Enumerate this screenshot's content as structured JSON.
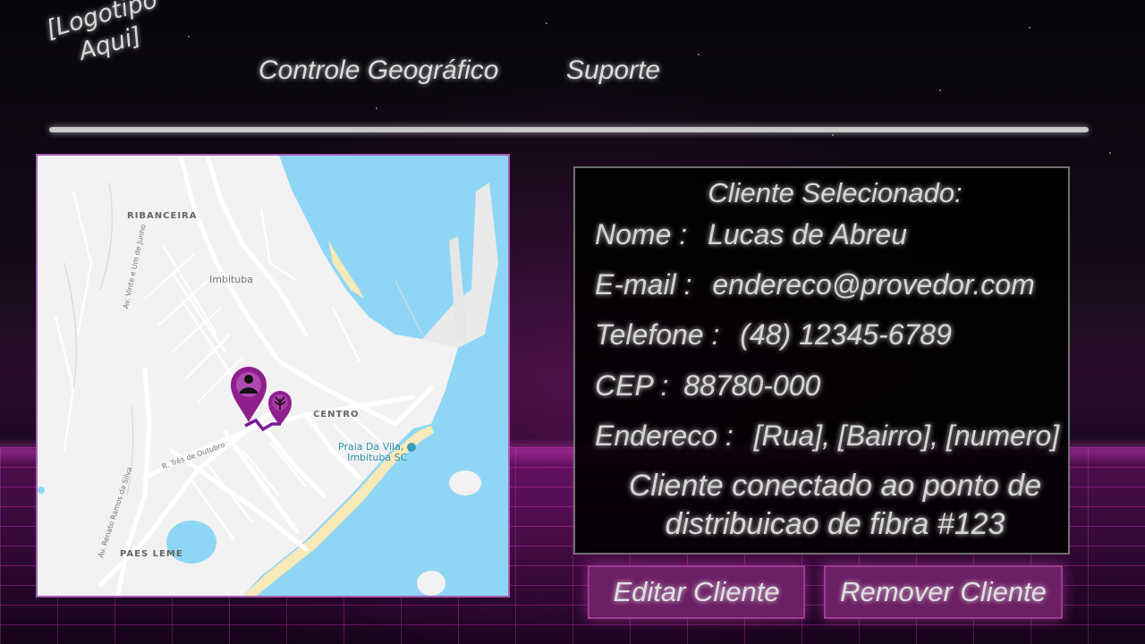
{
  "header": {
    "logo_line1": "[Logotipo",
    "logo_line2": "Aqui]",
    "nav": [
      {
        "label": "Controle Geográfico"
      },
      {
        "label": "Suporte"
      }
    ]
  },
  "map": {
    "labels": {
      "ribanceira": "RIBANCEIRA",
      "imbituba": "Imbituba",
      "centro": "CENTRO",
      "paes_leme": "PAES LEME",
      "poi_line1": "Praia Da Vila,",
      "poi_line2": "Imbituba SC",
      "street_vinte": "Av. Vinte e Um de Junho",
      "street_tres": "R. Três de Outubro",
      "street_renato": "Av. Renato Ramos da Silva"
    },
    "markers": [
      {
        "icon": "person-icon"
      },
      {
        "icon": "fiber-distribution-icon"
      }
    ],
    "colors": {
      "water": "#8fd6f6",
      "land": "#f2f2f2",
      "road": "#ffffff",
      "sand": "#f7e9b8",
      "marker": "#8e1f8d",
      "link": "#7a1a9e"
    }
  },
  "client": {
    "title": "Cliente Selecionado:",
    "name_label": "Nome :",
    "name_value": "Lucas de Abreu",
    "email_label": "E-mail :",
    "email_value": "endereco@provedor.com",
    "phone_label": "Telefone :",
    "phone_value": "(48) 12345-6789",
    "cep_label": "CEP :",
    "cep_value": "88780-000",
    "address_label": "Endereco :",
    "address_value": "[Rua], [Bairro], [numero]",
    "connection_line1": "Cliente conectado ao ponto de",
    "connection_line2": "distribuicao de fibra #123"
  },
  "actions": {
    "edit_label": "Editar Cliente",
    "remove_label": "Remover Cliente"
  },
  "theme": {
    "accent": "#6b1f64",
    "accent_border": "#9c3d93",
    "text_glow": "#d6d6d6"
  }
}
